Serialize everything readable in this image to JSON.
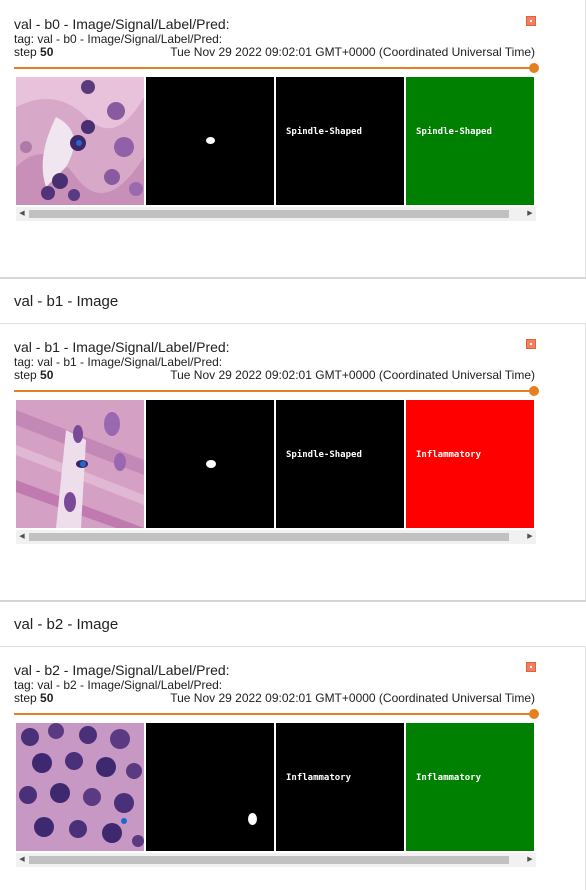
{
  "groups": [
    {
      "header": "",
      "run_title": "val - b0 - Image/Signal/Label/Pred:",
      "tag": "tag: val - b0 - Image/Signal/Label/Pred:",
      "step_label": "step",
      "step_value": "50",
      "timestamp": "Tue Nov 29 2022 09:02:01 GMT+0000 (Coordinated Universal Time)",
      "label_text": "Spindle-Shaped",
      "pred_text": "Spindle-Shaped",
      "pred_color": "#008000"
    },
    {
      "header": "val - b1 - Image",
      "run_title": "val - b1 - Image/Signal/Label/Pred:",
      "tag": "tag: val - b1 - Image/Signal/Label/Pred:",
      "step_label": "step",
      "step_value": "50",
      "timestamp": "Tue Nov 29 2022 09:02:01 GMT+0000 (Coordinated Universal Time)",
      "label_text": "Spindle-Shaped",
      "pred_text": "Inflammatory",
      "pred_color": "#ff0000"
    },
    {
      "header": "val - b2 - Image",
      "run_title": "val - b2 - Image/Signal/Label/Pred:",
      "tag": "tag: val - b2 - Image/Signal/Label/Pred:",
      "step_label": "step",
      "step_value": "50",
      "timestamp": "Tue Nov 29 2022 09:02:01 GMT+0000 (Coordinated Universal Time)",
      "label_text": "Inflammatory",
      "pred_text": "Inflammatory",
      "pred_color": "#008000"
    }
  ],
  "colors": {
    "slider": "#e67e22",
    "run_swatch": "#f08060"
  },
  "icons": {
    "scroll_left": "scroll-left-arrow-icon",
    "scroll_right": "scroll-right-arrow-icon"
  }
}
